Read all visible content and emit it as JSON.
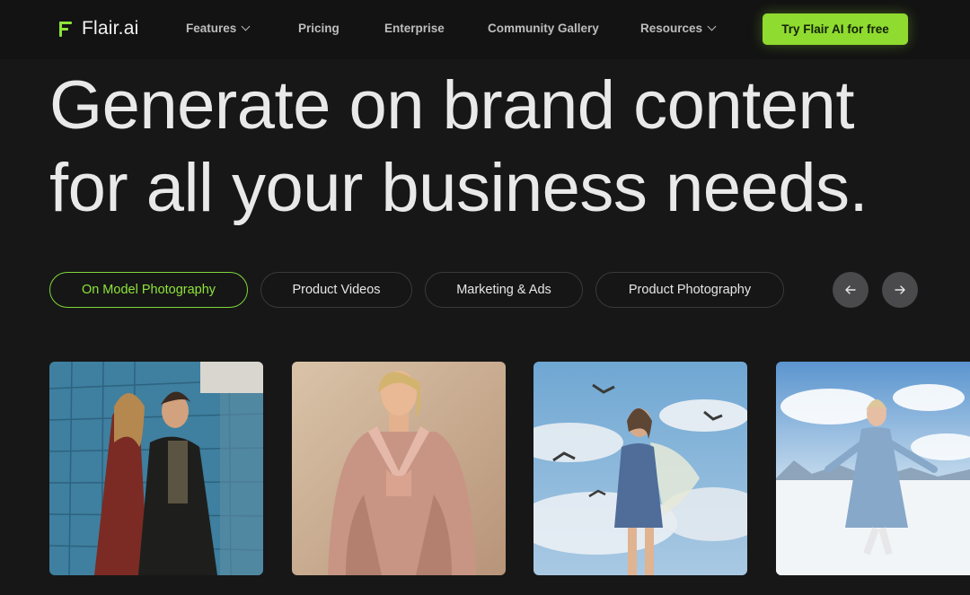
{
  "brand": {
    "name": "Flair.ai",
    "accent": "#8ee33a"
  },
  "nav": {
    "items": [
      {
        "label": "Features",
        "dropdown": true
      },
      {
        "label": "Pricing",
        "dropdown": false
      },
      {
        "label": "Enterprise",
        "dropdown": false
      },
      {
        "label": "Community Gallery",
        "dropdown": false
      },
      {
        "label": "Resources",
        "dropdown": true
      }
    ],
    "cta_label": "Try Flair AI  for free"
  },
  "hero": {
    "line1": "Generate on brand content",
    "line2": "for all your business needs."
  },
  "tabs": [
    {
      "label": "On Model Photography",
      "active": true
    },
    {
      "label": "Product Videos",
      "active": false
    },
    {
      "label": "Marketing & Ads",
      "active": false
    },
    {
      "label": "Product Photography",
      "active": false
    }
  ],
  "carousel": {
    "prev_icon": "arrow-left-icon",
    "next_icon": "arrow-right-icon"
  },
  "gallery": [
    {
      "subject": "couple-by-blue-tile-wall"
    },
    {
      "subject": "model-in-pink-satin-suit"
    },
    {
      "subject": "woman-with-birds-under-sky"
    },
    {
      "subject": "skater-on-snowy-field"
    }
  ]
}
